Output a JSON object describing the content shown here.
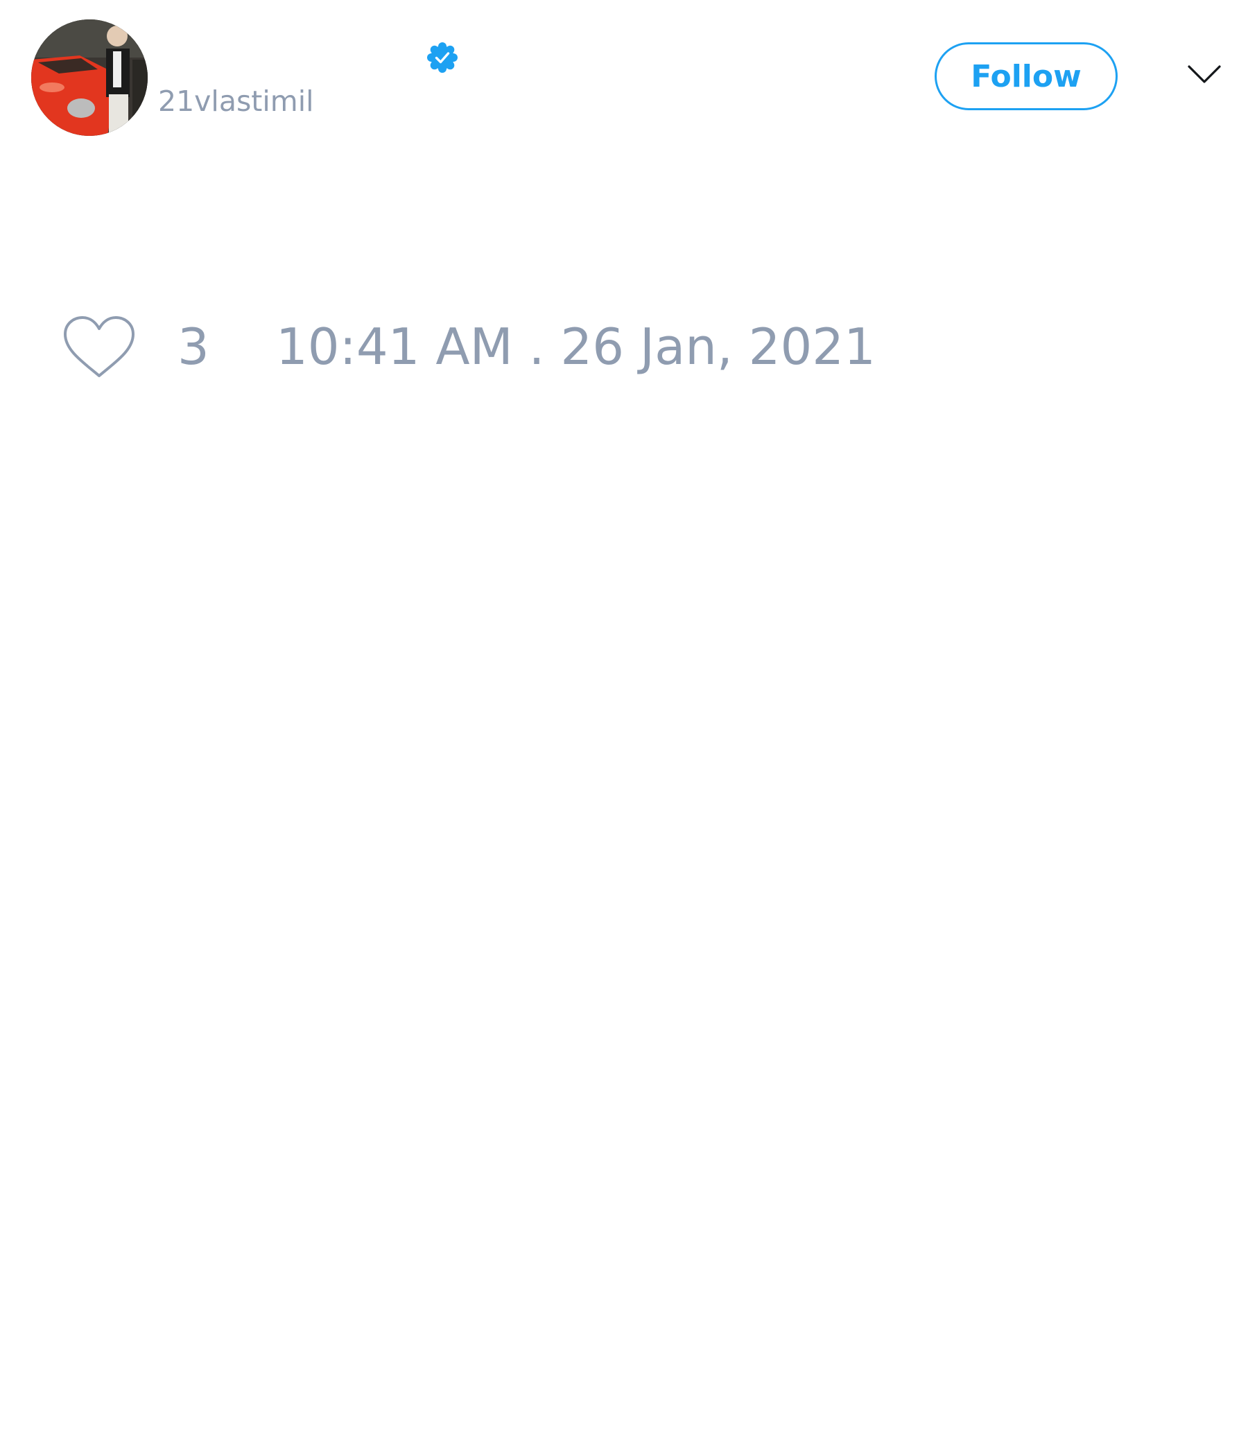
{
  "tweet": {
    "author": {
      "handle": "21vlastimil",
      "verified": true,
      "avatar_icon": "profile-photo-person-with-red-car"
    },
    "follow_label": "Follow",
    "more_icon": "chevron-down-icon",
    "likes": {
      "icon": "heart-icon",
      "count": "3"
    },
    "timestamp": "10:41 AM . 26 Jan, 2021"
  },
  "colors": {
    "accent": "#1da1f2",
    "muted_text": "#8f9cb0",
    "background": "#ffffff"
  }
}
